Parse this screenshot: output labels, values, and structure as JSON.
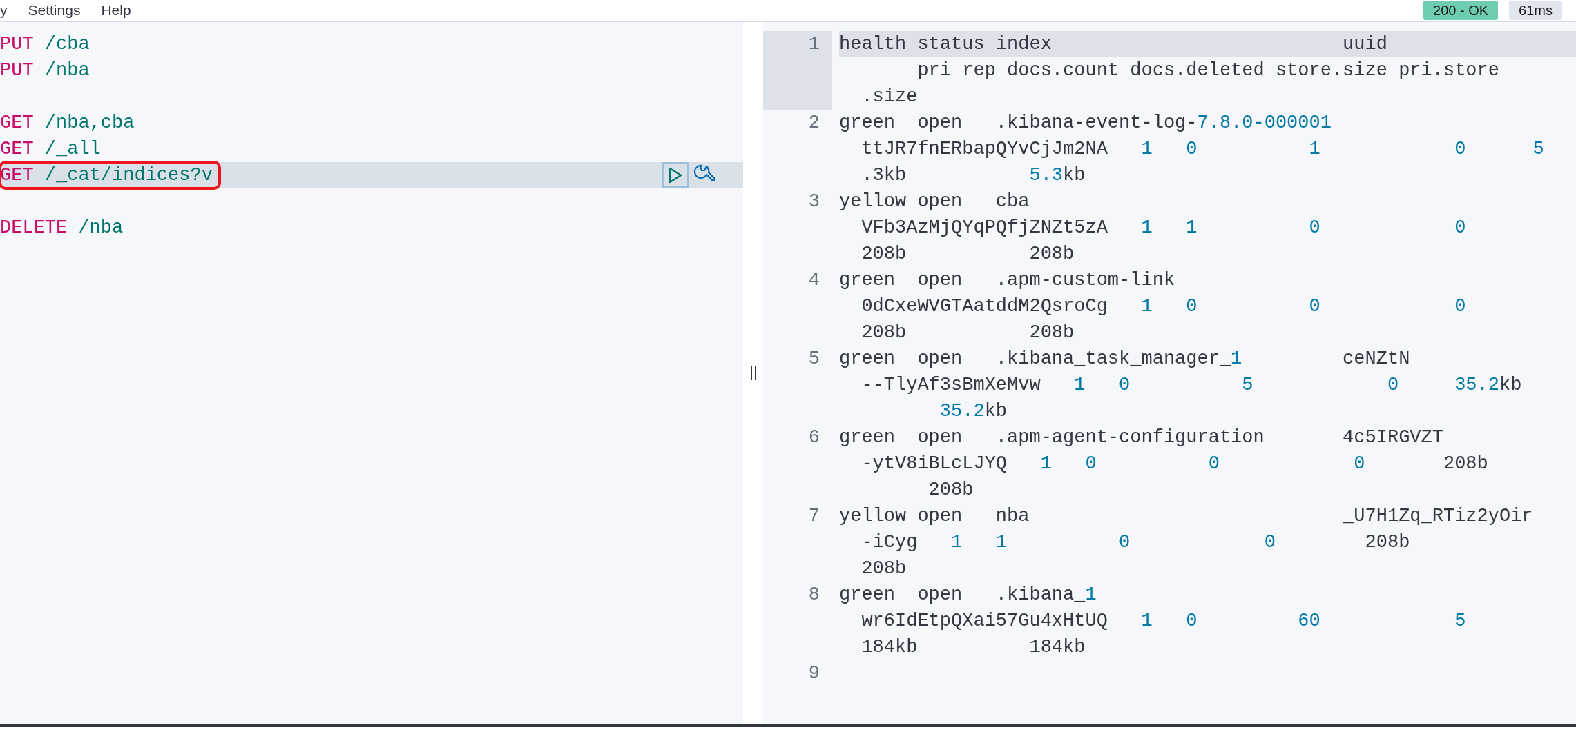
{
  "top_bar": {
    "menu": [
      "y",
      "Settings",
      "Help"
    ],
    "status_badge": "200 - OK",
    "time_badge": "61ms"
  },
  "editor": {
    "lines": [
      {
        "kind": "request",
        "method": "PUT",
        "path": "/cba",
        "active": false,
        "annotated": false
      },
      {
        "kind": "request",
        "method": "PUT",
        "path": "/nba",
        "active": false,
        "annotated": false
      },
      {
        "kind": "blank"
      },
      {
        "kind": "request",
        "method": "GET",
        "path": "/nba,cba",
        "active": false,
        "annotated": false
      },
      {
        "kind": "request",
        "method": "GET",
        "path": "/_all",
        "active": false,
        "annotated": false
      },
      {
        "kind": "request",
        "method": "GET",
        "path": "/_cat/indices?v",
        "active": true,
        "annotated": true
      },
      {
        "kind": "blank"
      },
      {
        "kind": "request",
        "method": "DELETE",
        "path": "/nba",
        "active": false,
        "annotated": false
      }
    ]
  },
  "output": {
    "lines": [
      {
        "number": "1",
        "active": true,
        "rows": [
          "health status index                          uuid",
          "       pri rep docs.count docs.deleted store.size pri.store",
          "  .size"
        ]
      },
      {
        "number": "2",
        "active": false,
        "rows": [
          "green  open   .kibana-event-log-7.8.0-000001",
          "  ttJR7fnERbapQYvCjJm2NA   1   0          1            0      5",
          "  .3kb           5.3kb"
        ]
      },
      {
        "number": "3",
        "active": false,
        "rows": [
          "yellow open   cba",
          "  VFb3AzMjQYqPQfjZNZt5zA   1   1          0            0",
          "  208b           208b"
        ]
      },
      {
        "number": "4",
        "active": false,
        "rows": [
          "green  open   .apm-custom-link",
          "  0dCxeWVGTAatddM2QsroCg   1   0          0            0",
          "  208b           208b"
        ]
      },
      {
        "number": "5",
        "active": false,
        "rows": [
          "green  open   .kibana_task_manager_1         ceNZtN",
          "  --TlyAf3sBmXeMvw   1   0          5            0     35.2kb",
          "         35.2kb"
        ]
      },
      {
        "number": "6",
        "active": false,
        "rows": [
          "green  open   .apm-agent-configuration       4c5IRGVZT",
          "  -ytV8iBLcLJYQ   1   0          0            0       208b",
          "        208b"
        ]
      },
      {
        "number": "7",
        "active": false,
        "rows": [
          "yellow open   nba                            _U7H1Zq_RTiz2yOir",
          "  -iCyg   1   1          0            0        208b",
          "  208b"
        ]
      },
      {
        "number": "8",
        "active": false,
        "rows": [
          "green  open   .kibana_1",
          "  wr6IdEtpQXai57Gu4xHtUQ   1   0         60            5",
          "  184kb          184kb"
        ]
      },
      {
        "number": "9",
        "active": false
      }
    ]
  }
}
